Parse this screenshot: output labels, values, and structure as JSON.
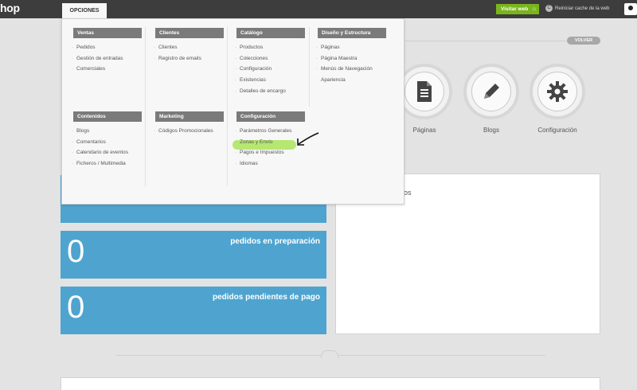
{
  "topbar": {
    "logo": "hop",
    "opciones_tab": "OPCIONES",
    "visit_button": "Visitar web",
    "reset_link": "Reiniciar cache de la web"
  },
  "volver": "VOLVER",
  "shortcuts": [
    {
      "label": "Páginas",
      "icon": "document-icon"
    },
    {
      "label": "Blogs",
      "icon": "pencil-icon"
    },
    {
      "label": "Configuración",
      "icon": "gear-icon"
    }
  ],
  "stats": [
    {
      "value": "0",
      "label": "pedidos en preparación"
    },
    {
      "value": "0",
      "label": "pedidos pendientes de pago"
    }
  ],
  "panel_title_fragment": "os",
  "menu": {
    "ventas": {
      "title": "Ventas",
      "items": [
        "Pedidos",
        "Gestión de entradas",
        "Comerciales"
      ]
    },
    "clientes": {
      "title": "Clientes",
      "items": [
        "Clientes",
        "Registro de emails"
      ]
    },
    "catalogo": {
      "title": "Catálogo",
      "items": [
        "Productos",
        "Colecciones",
        "Configuración",
        "Existencias",
        "Detalles de encargo"
      ]
    },
    "diseno": {
      "title": "Diseño y Estructura",
      "items": [
        "Páginas",
        "Página Maestra",
        "Menús de Navegación",
        "Apariencia"
      ]
    },
    "contenidos": {
      "title": "Contenidos",
      "items": [
        "Blogs",
        "Comentarios",
        "Calendario de eventos",
        "Ficheros / Multimedia"
      ]
    },
    "marketing": {
      "title": "Marketing",
      "items": [
        "Códigos Promocionales"
      ]
    },
    "configuracion": {
      "title": "Configuración",
      "items": [
        "Parámetros Generales",
        "Zonas y Envío",
        "Pagos e Impuestos",
        "Idiomas"
      ]
    }
  },
  "colors": {
    "topbar": "#3d3d3d",
    "accent_green": "#7ab51d",
    "stat_blue": "#4ea4cf",
    "highlight": "#a0e146"
  }
}
